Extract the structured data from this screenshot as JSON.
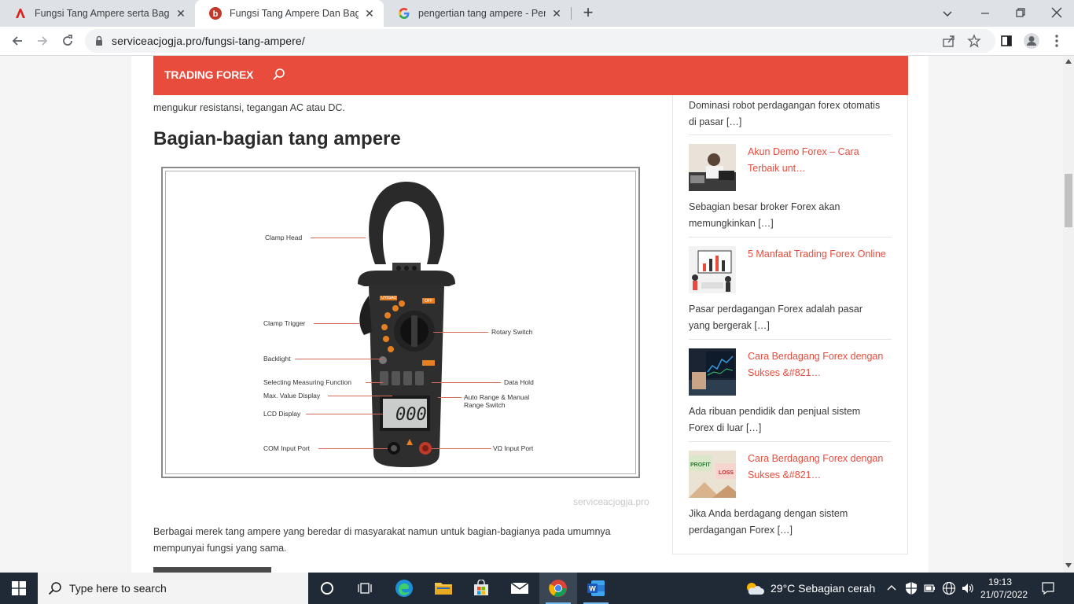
{
  "browser": {
    "tabs": [
      {
        "title": "Fungsi Tang Ampere serta Bagian",
        "icon": "adobe-icon",
        "active": false
      },
      {
        "title": "Fungsi Tang Ampere Dan Bagaim",
        "icon": "b-site-icon",
        "active": true
      },
      {
        "title": "pengertian tang ampere - Penelu",
        "icon": "google-icon",
        "active": false
      }
    ],
    "close_glyph": "✕",
    "new_tab_glyph": "+",
    "url": "serviceacjogja.pro/fungsi-tang-ampere/"
  },
  "site": {
    "brand": "TRADING FOREX",
    "accent_color": "#e74c3c"
  },
  "article": {
    "intro_line": "mengukur resistansi, tegangan AC atau DC.",
    "heading": "Bagian-bagian tang ampere",
    "figure_labels": {
      "clamp_head": "Clamp Head",
      "clamp_trigger": "Clamp Trigger",
      "backlight": "Backlight",
      "selecting": "Selecting Measuring Function",
      "max_value": "Max. Value Display",
      "lcd": "LCD Display",
      "com_port": "COM Input Port",
      "rotary": "Rotary Switch",
      "data_hold": "Data Hold",
      "auto_range": "Auto Range & Manual",
      "range_switch": "Range Switch",
      "vohm_port": "VΩ Input Port",
      "lcd_value": "000",
      "brand_text": "UYIGAO",
      "off_text": "OFF"
    },
    "caption": "serviceacjogja.pro",
    "paragraph_line1": "Berbagai merek tang ampere yang beredar di masyarakat namun untuk bagian-bagianya pada umumnya",
    "paragraph_line2": "mempunyai fungsi yang sama."
  },
  "sidebar": {
    "top_excerpt": [
      "Dominasi robot perdagangan forex otomatis",
      "di pasar […]"
    ],
    "items": [
      {
        "title_lines": [
          "Akun Demo Forex – Cara",
          "Terbaik unt…"
        ],
        "excerpt_lines": [
          "Sebagian besar broker Forex akan",
          "memungkinkan […]"
        ],
        "thumb": "trader-photo"
      },
      {
        "title_lines": [
          "5 Manfaat Trading Forex Online"
        ],
        "excerpt_lines": [
          "Pasar perdagangan Forex adalah pasar",
          "yang bergerak […]"
        ],
        "thumb": "chart-illustration"
      },
      {
        "title_lines": [
          "Cara Berdagang Forex dengan",
          "Sukses &#821…"
        ],
        "excerpt_lines": [
          "Ada ribuan pendidik dan penjual sistem",
          "Forex di luar […]"
        ],
        "thumb": "laptop-chart-photo"
      },
      {
        "title_lines": [
          "Cara Berdagang Forex dengan",
          "Sukses &#821…"
        ],
        "excerpt_lines": [
          "Jika Anda berdagang dengan sistem",
          "perdagangan Forex […]"
        ],
        "thumb": "profit-loss-illustration"
      }
    ]
  },
  "taskbar": {
    "search_placeholder": "Type here to search",
    "weather": "29°C  Sebagian cerah",
    "time": "19:13",
    "date": "21/07/2022"
  }
}
